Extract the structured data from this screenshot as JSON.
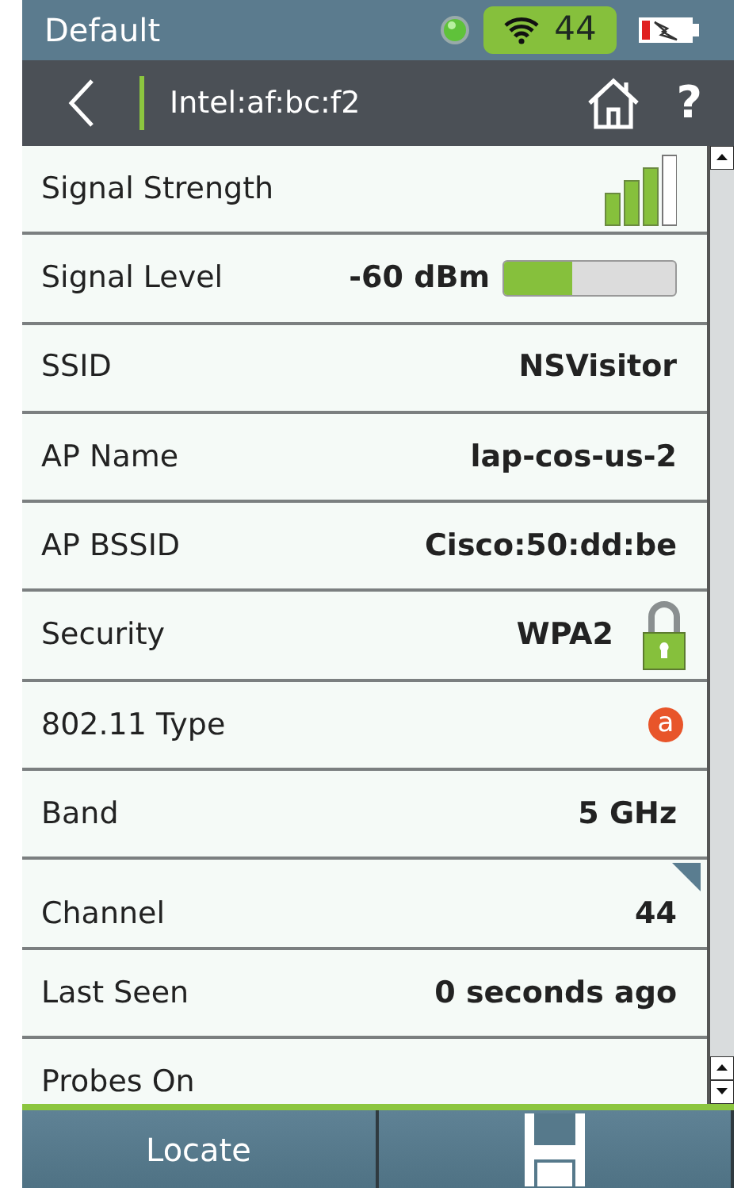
{
  "status_bar": {
    "profile": "Default",
    "channel": "44"
  },
  "nav_bar": {
    "title": "Intel:af:bc:f2",
    "help": "?"
  },
  "rows": [
    {
      "kind": "bars",
      "label": "Signal Strength",
      "level": 0.75
    },
    {
      "kind": "meter",
      "label": "Signal Level",
      "value": "-60 dBm",
      "level": 0.4
    },
    {
      "kind": "text",
      "label": "SSID",
      "value": "NSVisitor"
    },
    {
      "kind": "text",
      "label": "AP Name",
      "value": "lap-cos-us-2"
    },
    {
      "kind": "text",
      "label": "AP BSSID",
      "value": "Cisco:50:dd:be"
    },
    {
      "kind": "lock",
      "label": "Security",
      "value": "WPA2"
    },
    {
      "kind": "badge",
      "label": "802.11 Type",
      "value": "a"
    },
    {
      "kind": "text",
      "label": "Band",
      "value": "5 GHz"
    },
    {
      "kind": "corner",
      "label": "Channel",
      "value": "44"
    },
    {
      "kind": "text",
      "label": "Last Seen",
      "value": "0  seconds ago"
    },
    {
      "kind": "text",
      "label": "Probes On"
    }
  ],
  "buttons": [
    {
      "kind": "text",
      "label": "Locate"
    },
    {
      "kind": "save"
    }
  ]
}
